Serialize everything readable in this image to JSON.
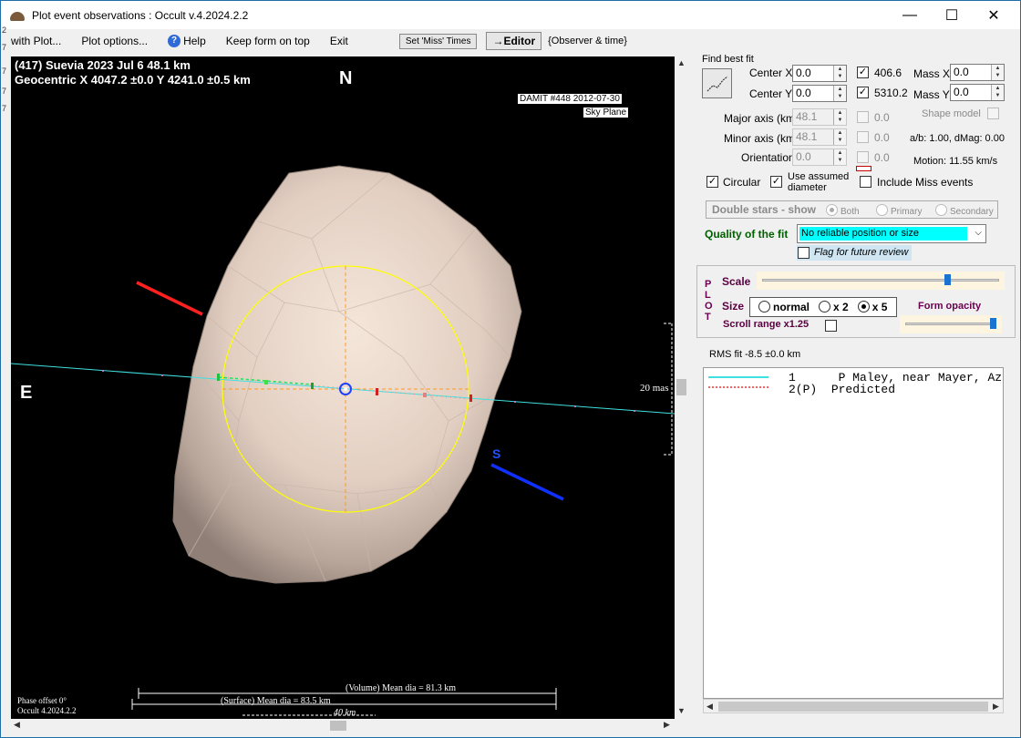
{
  "window": {
    "title": "Plot event observations : Occult v.4.2024.2.2",
    "minimize": "—",
    "maximize": "☐",
    "close": "✕"
  },
  "left_strip": [
    "2",
    "7",
    "7",
    "7",
    "7"
  ],
  "menu": {
    "with_plot": "with Plot...",
    "plot_options": "Plot options...",
    "help": "Help",
    "keep_on_top": "Keep form on top",
    "exit": "Exit",
    "set_miss_times": "Set 'Miss' Times",
    "editor": "→Editor",
    "observer_time": "{Observer & time}"
  },
  "plot": {
    "title_line1": "(417) Suevia  2023 Jul 6   48.1 km",
    "title_line2": "Geocentric  X  4047.2 ±0.0  Y 4241.0 ±0.5 km",
    "north": "N",
    "east": "E",
    "south": "S",
    "damit_label": "DAMIT #448 2012-07-30",
    "sky_plane_label": "Sky Plane",
    "scale_label": "20 mas",
    "phase_offset": "Phase offset 0°",
    "version": "Occult 4.2024.2.2",
    "volume_dia": "(Volume) Mean dia = 81.3 km",
    "surface_dia": "(Surface) Mean dia = 83.5 km",
    "km_bar": "40 km",
    "colors": {
      "background": "#000000",
      "shape": "#e4d2c5",
      "ellipse": "#ffff00",
      "chord": "#40e0e0",
      "north_pole": "#ff2020",
      "south_pole": "#1030ff"
    }
  },
  "panel": {
    "find_best_fit": "Find best fit",
    "center_x_label": "Center X",
    "center_x": "0.0",
    "center_y_label": "Center Y",
    "center_y": "0.0",
    "chk_406": "406.6",
    "chk_5310": "5310.2",
    "mass_x_label": "Mass X",
    "mass_x": "0.0",
    "mass_y_label": "Mass Y",
    "mass_y": "0.0",
    "major_axis_label": "Major axis (km)",
    "major_axis": "48.1",
    "minor_axis_label": "Minor axis (km)",
    "minor_axis": "48.1",
    "orientation_label": "Orientation",
    "orientation": "0.0",
    "dis1": "0.0",
    "dis2": "0.0",
    "dis3": "0.0",
    "shape_model": "Shape model",
    "ab_dmag": "a/b: 1.00, dMag: 0.00",
    "motion": "Motion: 11.55 km/s",
    "circular": "Circular",
    "use_assumed_1": "Use assumed",
    "use_assumed_2": "diameter",
    "include_miss": "Include Miss events",
    "double_stars": "Double stars - show",
    "both": "Both",
    "primary": "Primary",
    "secondary": "Secondary",
    "quality_label": "Quality of the fit",
    "quality_value": "No reliable position or size",
    "flag_review": "Flag for future review",
    "plot_letters": [
      "P",
      "L",
      "O",
      "T"
    ],
    "scale": "Scale",
    "size": "Size",
    "size_normal": "normal",
    "size_x2": "x 2",
    "size_x5": "x 5",
    "form_opacity": "Form opacity",
    "scroll_range": "Scroll range x1.25",
    "rms_fit": "RMS fit -8.5 ±0.0 km",
    "list": [
      {
        "num": "1",
        "text": "P Maley, near Mayer, Az"
      },
      {
        "num": "2(P)",
        "text": "Predicted"
      }
    ]
  }
}
